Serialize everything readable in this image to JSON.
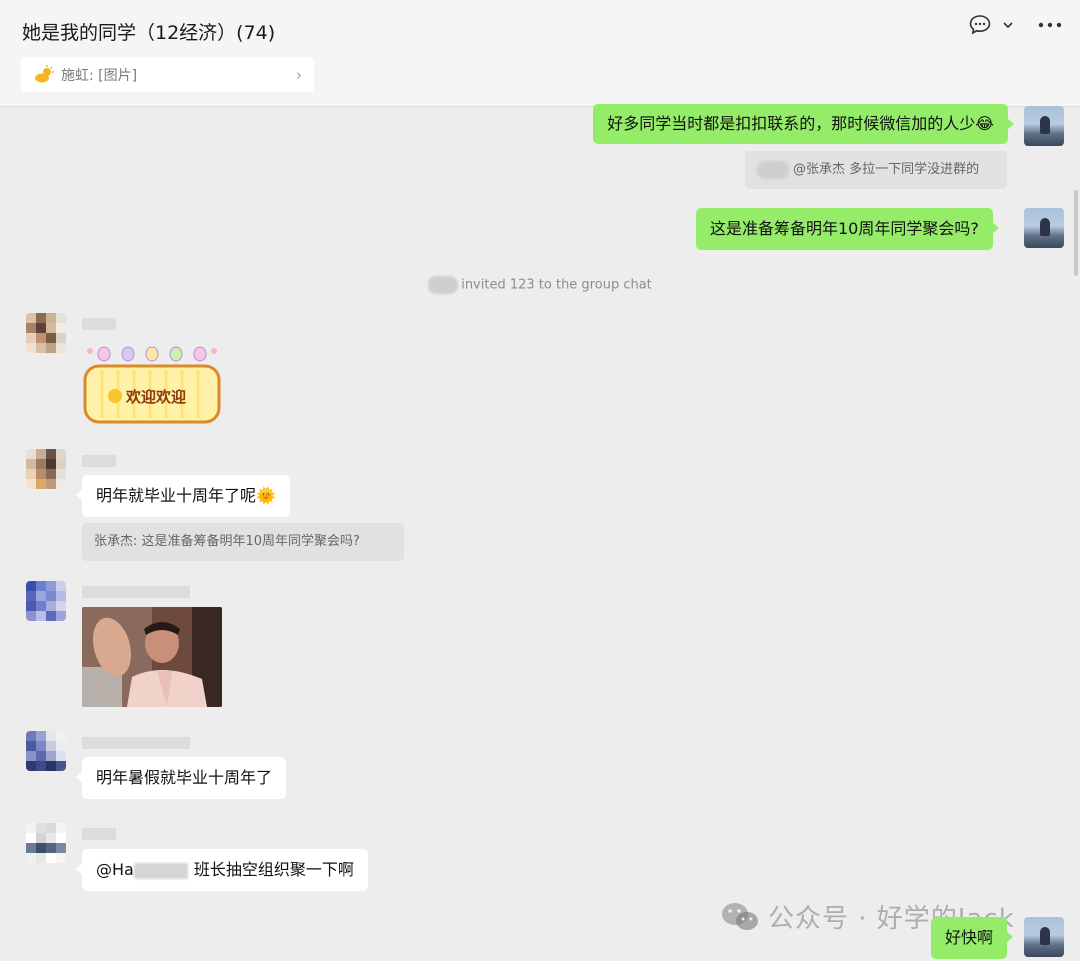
{
  "header": {
    "title": "她是我的同学（12经济）(74)",
    "notice": {
      "sender": "施虹:",
      "content": "[图片]"
    },
    "icons": [
      "chat-bubble-icon",
      "chevron-down-icon",
      "more-icon"
    ]
  },
  "messages": {
    "m1": "好多同学当时都是扣扣联系的，那时候微信加的人少😂",
    "q1": "@张承杰 多拉一下同学没进群的",
    "m2": "这是准备筹备明年10周年同学聚会吗?",
    "system": "invited 123 to the group chat",
    "sticker_text": "欢迎欢迎",
    "m3": "明年就毕业十周年了呢🌞",
    "q2": "张承杰: 这是准备筹备明年10周年同学聚会吗?",
    "m4": "明年暑假就毕业十周年了",
    "m5_prefix": "@Ha",
    "m5_suffix": "班长抽空组织聚一下啊",
    "m6": "好快啊"
  },
  "watermark": "公众号 · 好学的Jack",
  "colors": {
    "self_bubble": "#95ec69",
    "other_bubble": "#ffffff",
    "background": "#ededed"
  }
}
